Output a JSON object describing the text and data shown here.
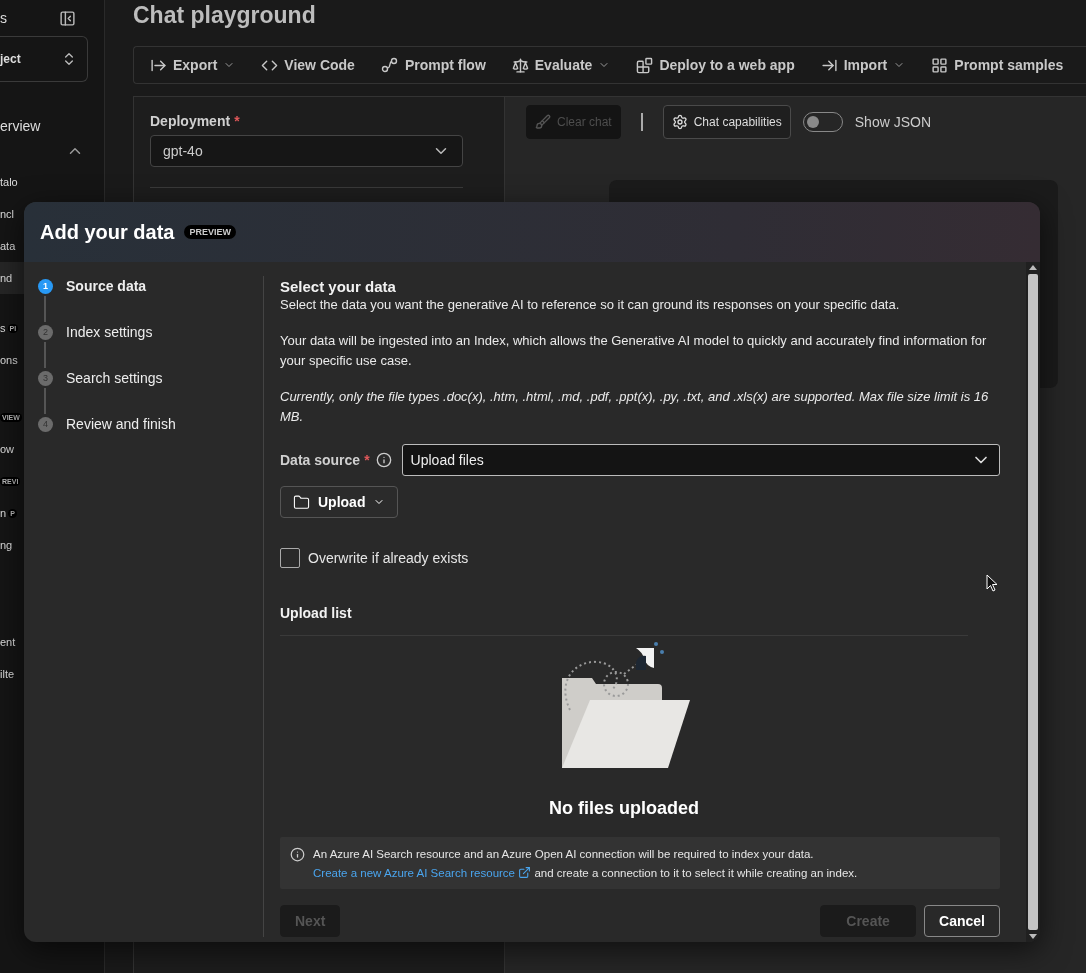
{
  "sidebar": {
    "header_text": "s",
    "project": "ject",
    "groups": [
      {
        "collapsible": false,
        "items": [
          {
            "label": "erview",
            "selected": false
          }
        ]
      },
      {
        "collapsible": true,
        "items": [
          {
            "label": "talo",
            "selected": false
          },
          {
            "label": "ncl",
            "selected": false
          },
          {
            "label": "ata",
            "selected": false
          },
          {
            "label": "nd",
            "selected": true
          }
        ]
      },
      {
        "collapsible": false,
        "items": [
          {
            "label": "s",
            "badge": "PI",
            "selected": false
          },
          {
            "label": "ons",
            "selected": false
          }
        ]
      },
      {
        "collapsible": false,
        "items": [
          {
            "badge": "VIEW",
            "selected": false
          },
          {
            "label": "ow",
            "selected": false
          },
          {
            "badge": "REVI",
            "selected": false
          },
          {
            "label": "n",
            "badge": "P",
            "selected": false
          },
          {
            "label": "ng",
            "selected": false
          }
        ]
      },
      {
        "collapsible": false,
        "items": [
          {
            "label": "ent",
            "selected": false
          },
          {
            "label": "ilte",
            "selected": false
          }
        ]
      }
    ]
  },
  "page_title": "Chat playground",
  "toolbar": [
    {
      "label": "Export",
      "has_menu": true
    },
    {
      "label": "View Code",
      "has_menu": false
    },
    {
      "label": "Prompt flow",
      "has_menu": false
    },
    {
      "label": "Evaluate",
      "has_menu": true
    },
    {
      "label": "Deploy to a web app",
      "has_menu": false
    },
    {
      "label": "Import",
      "has_menu": true
    },
    {
      "label": "Prompt samples",
      "has_menu": false
    }
  ],
  "setup_panel": {
    "label": "Deployment",
    "required_mark": "*",
    "value": "gpt-4o"
  },
  "chat_toolbar": {
    "clear_chat": {
      "label": "Clear chat",
      "disabled": true
    },
    "capabilities": {
      "label": "Chat capabilities",
      "disabled": false
    },
    "json_toggle": {
      "label": "Show JSON",
      "on": false
    }
  },
  "modal": {
    "title": "Add your data",
    "badge": "PREVIEW",
    "steps": [
      {
        "number": "1",
        "label": "Source data",
        "selected": true
      },
      {
        "number": "2",
        "label": "Index settings",
        "selected": false
      },
      {
        "number": "3",
        "label": "Search settings",
        "selected": false
      },
      {
        "number": "4",
        "label": "Review and finish",
        "selected": false
      }
    ],
    "heading": "Select your data",
    "description": "Select the data you want the generative AI to reference so it can ground its responses on your specific data.",
    "paragraph": "Your data will be ingested into an Index, which allows the Generative AI model to quickly and accurately find information for your specific use case.",
    "note": "Currently, only the file types .doc(x), .htm, .html, .md, .pdf, .ppt(x), .py, .txt, and .xls(x) are supported. Max file size limit is 16 MB.",
    "data_source": {
      "label": "Data source",
      "required_mark": "*",
      "value": "Upload files"
    },
    "upload_button": {
      "label": "Upload"
    },
    "overwrite": {
      "label": "Overwrite if already exists",
      "checked": false
    },
    "upload_list": {
      "title": "Upload list",
      "empty_text": "No files uploaded"
    },
    "info": {
      "text": "An Azure AI Search resource and an Azure Open AI connection will be required to index your data.",
      "link": "Create a new Azure AI Search resource",
      "text_after": "and create a connection to it to select it while creating an index."
    },
    "buttons": [
      {
        "label": "Next",
        "kind": "secondary",
        "disabled": true
      },
      {
        "label": "Create",
        "kind": "primary",
        "disabled": true
      },
      {
        "label": "Cancel",
        "kind": "secondary",
        "disabled": false
      }
    ]
  }
}
